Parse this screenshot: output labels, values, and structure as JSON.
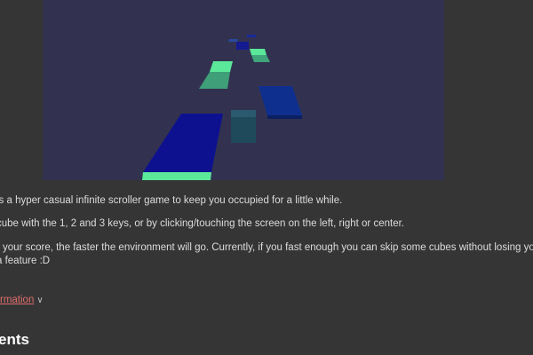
{
  "game": {
    "fullscreen_icon": "expand-arrows-icon",
    "background_color": "#323250",
    "tile_blue": "#0d118f",
    "tile_green": "#5be89a",
    "tile_cube": "#1e4a5c"
  },
  "description": {
    "line1": "is a hyper casual infinite scroller game to keep you occupied for a little while.",
    "line2": "cube with the 1, 2 and 3 keys, or by clicking/touching the screen on the left, right or center.",
    "line3": "r your score, the faster the environment will go. Currently, if you fast enough you can skip some cubes without losing your",
    "line4": "a feature :D"
  },
  "more_info": {
    "link_label": "rmation",
    "chevron_icon": "chevron-down-icon"
  },
  "comments": {
    "heading": "ents"
  }
}
